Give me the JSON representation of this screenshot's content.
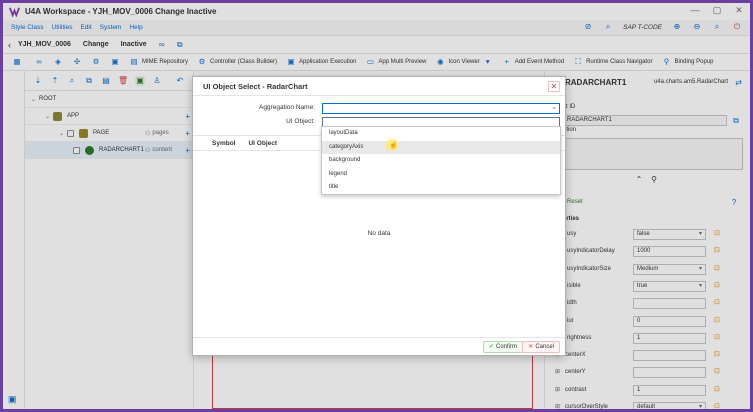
{
  "window": {
    "title": "U4A Workspace - YJH_MOV_0006 Change Inactive"
  },
  "menu": {
    "items": [
      "Style Class",
      "Utilities",
      "Edit",
      "System",
      "Help"
    ],
    "tcode": "SAP T-CODE"
  },
  "object": {
    "name": "YJH_MOV_0006",
    "mode": "Change",
    "state": "Inactive"
  },
  "toolbar": {
    "mime": "MIME Repository",
    "controller": "Controller (Class Builder)",
    "app_exec": "Application Execution",
    "multi_preview": "App Multi Preview",
    "icon_viewer": "Icon Viewer",
    "add_event": "Add Event Method",
    "runtime_nav": "Runtime Class Navigator",
    "binding_popup": "Binding Popup"
  },
  "tree": {
    "nodes": [
      {
        "label": "ROOT",
        "agg": ""
      },
      {
        "label": "APP",
        "agg": ""
      },
      {
        "label": "PAGE",
        "agg": "pages"
      },
      {
        "label": "RADARCHART1",
        "agg": "content"
      }
    ]
  },
  "properties": {
    "title": "RADARCHART1",
    "class_name": "u4a.charts.am5.RadarChart",
    "object_id_label": "ct ID",
    "object_id_value": "RADARCHART1",
    "description_label": "ption",
    "reset_label": "Reset",
    "section_label": "erties",
    "rows": [
      {
        "label": "usy",
        "value": "false",
        "type": "select"
      },
      {
        "label": "usyIndicatorDelay",
        "value": "1000",
        "type": "input"
      },
      {
        "label": "usyIndicatorSize",
        "value": "Medium",
        "type": "select"
      },
      {
        "label": "isible",
        "value": "true",
        "type": "select"
      },
      {
        "label": "idth",
        "value": "",
        "type": "input"
      },
      {
        "label": "lur",
        "value": "0",
        "type": "input"
      },
      {
        "label": "rightness",
        "value": "1",
        "type": "input"
      },
      {
        "label": "centerX",
        "value": "",
        "type": "input"
      },
      {
        "label": "centerY",
        "value": "",
        "type": "input"
      },
      {
        "label": "contrast",
        "value": "1",
        "type": "input"
      },
      {
        "label": "cursorOverStyle",
        "value": "default",
        "type": "select"
      }
    ]
  },
  "dialog": {
    "title": "UI Object Select - RadarChart",
    "aggregation_label": "Aggregation Name:",
    "uiobject_label": "UI Object:",
    "columns": [
      "Symbol",
      "UI Object"
    ],
    "no_data": "No data",
    "confirm": "Confirm",
    "cancel": "Cancel"
  },
  "dropdown": {
    "options": [
      "layoutData",
      "categoryAxis",
      "background",
      "legend",
      "title"
    ],
    "hovered": "categoryAxis"
  },
  "colors": {
    "accent": "#0a6ed1",
    "frame": "#6b3fa0",
    "positive": "#2b7d2b",
    "negative": "#d04343"
  }
}
